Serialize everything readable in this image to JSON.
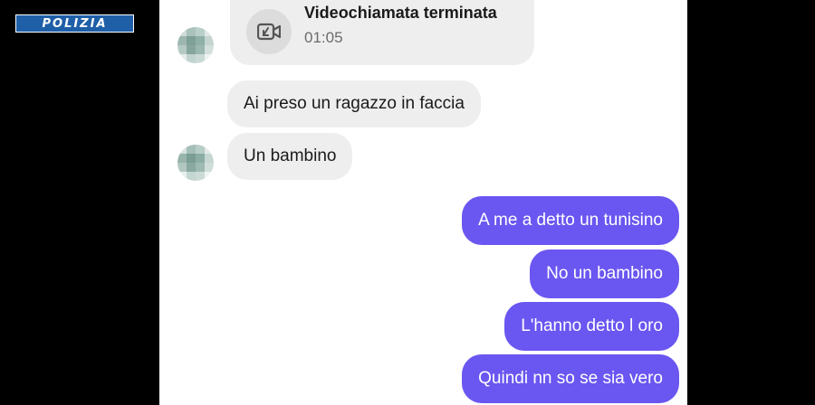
{
  "watermark": {
    "logo_text": "POLIZIA",
    "bg_color": "#1f5fa8"
  },
  "colors": {
    "incoming_bubble": "#eeeeee",
    "outgoing_bubble": "#6a56f0",
    "chat_background": "#ffffff"
  },
  "call": {
    "icon": "video-call-ended-icon",
    "title": "Videochiamata terminata",
    "duration": "01:05"
  },
  "incoming_messages": [
    {
      "text": "Ai preso un ragazzo in faccia"
    },
    {
      "text": "Un bambino"
    }
  ],
  "outgoing_messages": [
    {
      "text": "A me a detto un tunisino"
    },
    {
      "text": "No un bambino"
    },
    {
      "text": "L'hanno detto l oro"
    },
    {
      "text": "Quindi nn so se sia vero"
    }
  ]
}
